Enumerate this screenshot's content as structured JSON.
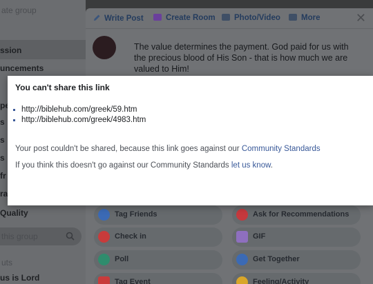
{
  "sidebar": {
    "header": "ate group",
    "items": [
      {
        "label": "ssion"
      },
      {
        "label": "uncements"
      },
      {
        "label": "Quality"
      },
      {
        "label": "this group"
      },
      {
        "label": "uts"
      },
      {
        "label": "us is Lord"
      }
    ],
    "fragments": [
      "per",
      "s",
      "s",
      "s",
      "fr",
      "ra"
    ]
  },
  "composer": {
    "tabs": [
      {
        "label": "Write Post",
        "icon": "pencil-icon"
      },
      {
        "label": "Create Room",
        "icon": "video-icon"
      },
      {
        "label": "Photo/Video",
        "icon": "photo-icon"
      },
      {
        "label": "More",
        "icon": "grid-icon"
      }
    ],
    "close_label": "✕",
    "post_text": "The value determines the payment. God paid for us with the precious blood of His Son - that is how much we are valued to Him!",
    "options": [
      {
        "label": "Tag Friends",
        "icon": "tag-friends-icon",
        "color": "#3b6ab5"
      },
      {
        "label": "Ask for Recommendations",
        "icon": "recommendations-icon",
        "color": "#c5393d"
      },
      {
        "label": "Check in",
        "icon": "checkin-icon",
        "color": "#c83b3b"
      },
      {
        "label": "GIF",
        "icon": "gif-icon",
        "color": "#8e6fbf"
      },
      {
        "label": "Poll",
        "icon": "poll-icon",
        "color": "#2f8c6d"
      },
      {
        "label": "Get Together",
        "icon": "get-together-icon",
        "color": "#3b6ab5"
      },
      {
        "label": "Tag Event",
        "icon": "tag-event-icon",
        "color": "#c83b3b"
      },
      {
        "label": "Feeling/Activity",
        "icon": "feeling-icon",
        "color": "#d9a629"
      }
    ]
  },
  "dialog": {
    "title": "You can't share this link",
    "links": [
      "http://biblehub.com/greek/59.htm",
      "http://biblehub.com/greek/4983.htm"
    ],
    "message_prefix": "Your post couldn't be shared, because this link goes against our ",
    "message_link": "Community Standards",
    "note_prefix": "If you think this doesn't go against our Community Standards ",
    "note_link": "let us know",
    "note_suffix": "."
  },
  "colors": {
    "accent": "#385898",
    "dialog_bg": "#ffffff",
    "overlay": "#3a3b3c"
  }
}
